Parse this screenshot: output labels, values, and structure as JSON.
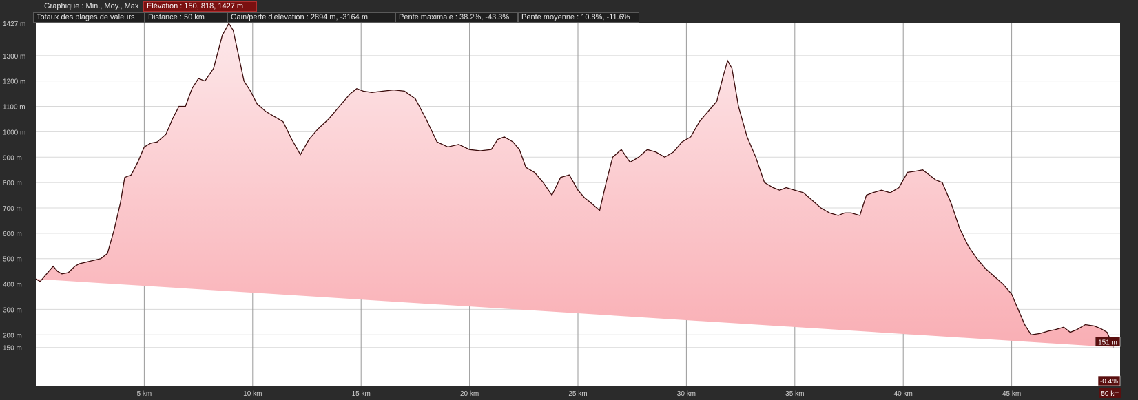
{
  "header": {
    "graph_label": "Graphique : Min., Moy., Max",
    "elevation_label": "Élévation : 150, 818, 1427 m"
  },
  "totals": {
    "label": "Totaux des plages de valeurs",
    "distance": "Distance : 50 km",
    "gain_loss": "Gain/perte d'élévation : 2894 m, -3164 m",
    "max_slope": "Pente maximale : 38.2%, -43.3%",
    "avg_slope": "Pente moyenne : 10.8%, -11.6%"
  },
  "colors": {
    "background": "#2b2b2b",
    "plot_background": "#ffffff",
    "area_top": "#fde8ea",
    "area_bottom": "#f9aeb4",
    "line": "#3a0a0a",
    "grid": "#9a9a9a",
    "flag": "#5a0f0f"
  },
  "chart_data": {
    "type": "area",
    "xlabel": "",
    "ylabel": "",
    "xlim": [
      0,
      50
    ],
    "ylim": [
      0,
      1427
    ],
    "grid": true,
    "x_ticks": [
      5,
      10,
      15,
      20,
      25,
      30,
      35,
      40,
      45,
      50
    ],
    "x_tick_labels": [
      "5 km",
      "10 km",
      "15 km",
      "20 km",
      "25 km",
      "30 km",
      "35 km",
      "40 km",
      "45 km",
      "50 km"
    ],
    "y_ticks": [
      150,
      200,
      300,
      400,
      500,
      600,
      700,
      800,
      900,
      1000,
      1100,
      1200,
      1300,
      1427
    ],
    "y_tick_labels": [
      "150 m",
      "200 m",
      "300 m",
      "400 m",
      "500 m",
      "600 m",
      "700 m",
      "800 m",
      "900 m",
      "1000 m",
      "1100 m",
      "1200 m",
      "1300 m",
      "1427 m"
    ],
    "current_elevation_label": "151 m",
    "current_slope_label": "-0.4%",
    "x": [
      0,
      0.2,
      0.5,
      0.8,
      1.0,
      1.2,
      1.5,
      1.8,
      2.0,
      2.5,
      3.0,
      3.3,
      3.6,
      3.9,
      4.1,
      4.4,
      4.7,
      5.0,
      5.3,
      5.6,
      6.0,
      6.3,
      6.6,
      6.9,
      7.2,
      7.5,
      7.8,
      8.2,
      8.6,
      8.9,
      9.1,
      9.3,
      9.6,
      9.9,
      10.2,
      10.6,
      11.0,
      11.4,
      11.8,
      12.2,
      12.6,
      13.0,
      13.5,
      14.0,
      14.5,
      14.8,
      15.1,
      15.5,
      16.0,
      16.5,
      17.0,
      17.5,
      18.0,
      18.5,
      19.0,
      19.5,
      20.0,
      20.5,
      21.0,
      21.3,
      21.6,
      22.0,
      22.3,
      22.6,
      23.0,
      23.4,
      23.8,
      24.2,
      24.6,
      25.0,
      25.3,
      25.6,
      26.0,
      26.3,
      26.6,
      27.0,
      27.4,
      27.8,
      28.2,
      28.6,
      29.0,
      29.4,
      29.8,
      30.2,
      30.6,
      31.0,
      31.4,
      31.7,
      31.9,
      32.1,
      32.4,
      32.8,
      33.2,
      33.6,
      34.0,
      34.3,
      34.6,
      35.0,
      35.4,
      35.8,
      36.2,
      36.6,
      37.0,
      37.3,
      37.6,
      38.0,
      38.3,
      38.6,
      39.0,
      39.4,
      39.8,
      40.2,
      40.6,
      40.9,
      41.2,
      41.5,
      41.8,
      42.2,
      42.6,
      43.0,
      43.4,
      43.8,
      44.2,
      44.6,
      45.0,
      45.3,
      45.6,
      45.9,
      46.3,
      46.7,
      47.0,
      47.4,
      47.7,
      48.0,
      48.4,
      48.8,
      49.1,
      49.4,
      49.7,
      50.0
    ],
    "y": [
      420,
      410,
      440,
      470,
      450,
      440,
      445,
      470,
      480,
      490,
      500,
      520,
      610,
      720,
      820,
      830,
      880,
      940,
      955,
      960,
      990,
      1050,
      1100,
      1100,
      1170,
      1210,
      1200,
      1250,
      1380,
      1427,
      1400,
      1320,
      1200,
      1160,
      1110,
      1080,
      1060,
      1040,
      970,
      910,
      970,
      1010,
      1050,
      1100,
      1150,
      1170,
      1160,
      1155,
      1160,
      1165,
      1160,
      1130,
      1050,
      960,
      940,
      950,
      930,
      925,
      930,
      970,
      980,
      960,
      930,
      860,
      840,
      800,
      750,
      820,
      830,
      770,
      740,
      720,
      690,
      800,
      900,
      930,
      880,
      900,
      930,
      920,
      900,
      920,
      960,
      980,
      1040,
      1080,
      1120,
      1220,
      1280,
      1250,
      1100,
      980,
      900,
      800,
      780,
      770,
      780,
      770,
      760,
      730,
      700,
      680,
      670,
      680,
      680,
      670,
      750,
      760,
      770,
      760,
      780,
      840,
      845,
      850,
      830,
      810,
      800,
      720,
      620,
      550,
      500,
      460,
      430,
      400,
      360,
      300,
      240,
      200,
      205,
      215,
      220,
      230,
      210,
      220,
      240,
      235,
      225,
      210,
      151
    ]
  }
}
